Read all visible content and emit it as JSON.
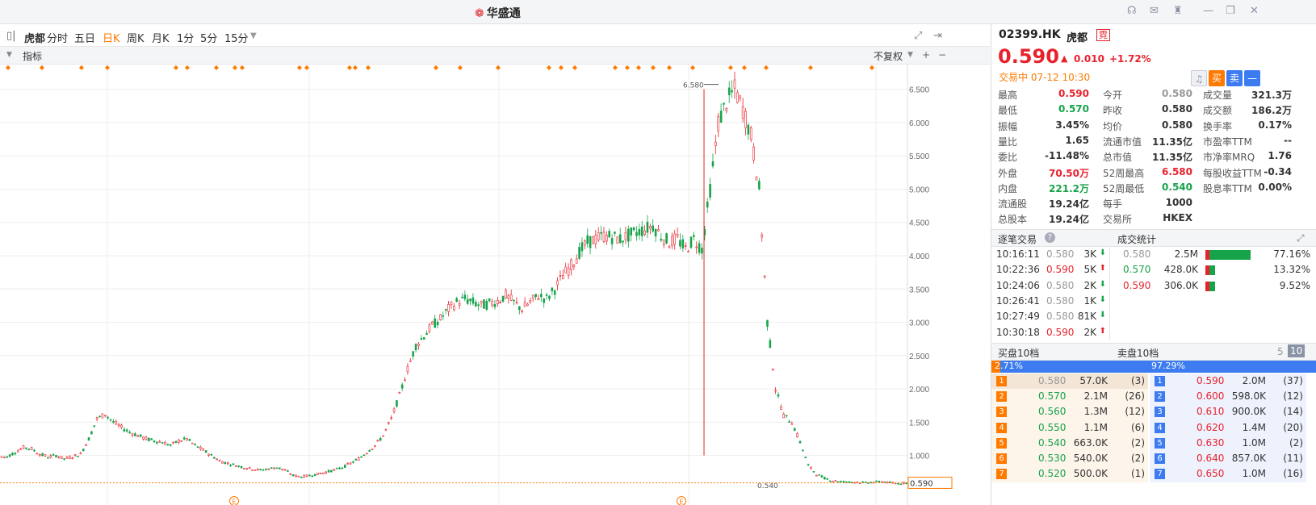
{
  "app": {
    "title": "华盛通"
  },
  "toolbar": {
    "name": "虎都",
    "periods": [
      "分时",
      "五日",
      "日K",
      "周K",
      "月K",
      "1分",
      "5分",
      "15分"
    ],
    "active_period": "日K"
  },
  "indicator_bar": {
    "label": "指标",
    "adjust": "不复权",
    "plus": "+",
    "minus": "−"
  },
  "chart_data": {
    "type": "candlestick",
    "yaxis_ticks": [
      "6.500",
      "6.000",
      "5.500",
      "5.000",
      "4.500",
      "4.000",
      "3.500",
      "3.000",
      "2.500",
      "2.000",
      "1.500",
      "1.000"
    ],
    "ylim": [
      0.45,
      6.75
    ],
    "current_price_label": "0.590",
    "annotations": {
      "high": "6.580",
      "low": "0.540"
    },
    "event_markers": [
      "E",
      "E"
    ],
    "closes_approx": [
      0.98,
      1.05,
      1.12,
      1.1,
      1.02,
      0.98,
      1.0,
      0.95,
      0.98,
      1.02,
      1.25,
      1.55,
      1.62,
      1.5,
      1.42,
      1.35,
      1.3,
      1.25,
      1.22,
      1.2,
      1.15,
      1.22,
      1.25,
      1.15,
      1.08,
      1.0,
      0.92,
      0.88,
      0.85,
      0.82,
      0.8,
      0.78,
      0.8,
      0.82,
      0.78,
      0.7,
      0.68,
      0.7,
      0.72,
      0.75,
      0.78,
      0.82,
      0.88,
      0.95,
      1.05,
      1.15,
      1.3,
      1.55,
      1.9,
      2.3,
      2.65,
      2.8,
      2.95,
      3.05,
      3.2,
      3.3,
      3.35,
      3.3,
      3.25,
      3.28,
      3.32,
      3.4,
      3.3,
      3.2,
      3.3,
      3.4,
      3.35,
      3.5,
      3.7,
      3.85,
      4.05,
      4.2,
      4.25,
      4.3,
      4.28,
      4.25,
      4.3,
      4.35,
      4.4,
      4.45,
      4.3,
      4.2,
      4.25,
      4.1,
      4.25,
      4.1,
      5.0,
      6.0,
      6.3,
      6.5,
      6.2,
      5.8,
      5.0,
      3.0,
      2.0,
      1.6,
      1.5,
      1.2,
      0.85,
      0.72,
      0.66,
      0.62,
      0.61,
      0.6,
      0.6,
      0.59,
      0.6,
      0.61,
      0.59,
      0.58,
      0.59
    ]
  },
  "quote": {
    "code": "02399.HK",
    "name": "虎都",
    "badge": "霓",
    "price": "0.590",
    "arrow": "▲",
    "change": "0.010",
    "change_pct": "+1.72%",
    "status": "交易中 07-12 10:30",
    "buy_label": "买",
    "sell_label": "卖",
    "menu_label": "—"
  },
  "stats": [
    [
      {
        "l": "最高",
        "v": "0.590",
        "c": "red"
      },
      {
        "l": "今开",
        "v": "0.580",
        "c": "grey"
      },
      {
        "l": "成交量",
        "v": "321.3万",
        "c": ""
      }
    ],
    [
      {
        "l": "最低",
        "v": "0.570",
        "c": "green"
      },
      {
        "l": "昨收",
        "v": "0.580",
        "c": ""
      },
      {
        "l": "成交额",
        "v": "186.2万",
        "c": ""
      }
    ],
    [
      {
        "l": "振幅",
        "v": "3.45%",
        "c": ""
      },
      {
        "l": "均价",
        "v": "0.580",
        "c": ""
      },
      {
        "l": "换手率",
        "v": "0.17%",
        "c": ""
      }
    ],
    [
      {
        "l": "量比",
        "v": "1.65",
        "c": ""
      },
      {
        "l": "流通市值",
        "v": "11.35亿",
        "c": ""
      },
      {
        "l": "市盈率TTM",
        "v": "--",
        "c": ""
      }
    ],
    [
      {
        "l": "委比",
        "v": "-11.48%",
        "c": ""
      },
      {
        "l": "总市值",
        "v": "11.35亿",
        "c": ""
      },
      {
        "l": "市净率MRQ",
        "v": "1.76",
        "c": ""
      }
    ],
    [
      {
        "l": "外盘",
        "v": "70.50万",
        "c": "red"
      },
      {
        "l": "52周最高",
        "v": "6.580",
        "c": "red"
      },
      {
        "l": "每股收益TTM",
        "v": "-0.34",
        "c": ""
      }
    ],
    [
      {
        "l": "内盘",
        "v": "221.2万",
        "c": "green"
      },
      {
        "l": "52周最低",
        "v": "0.540",
        "c": "green"
      },
      {
        "l": "股息率TTM",
        "v": "0.00%",
        "c": ""
      }
    ],
    [
      {
        "l": "流通股",
        "v": "19.24亿",
        "c": ""
      },
      {
        "l": "每手",
        "v": "1000",
        "c": ""
      },
      null
    ],
    [
      {
        "l": "总股本",
        "v": "19.24亿",
        "c": ""
      },
      {
        "l": "交易所",
        "v": "HKEX",
        "c": ""
      },
      null
    ]
  ],
  "ticks": {
    "title": "逐笔交易",
    "help": "?",
    "rows": [
      {
        "time": "10:16:11",
        "price": "0.580",
        "vol": "3K",
        "dir": "down",
        "c": "grey"
      },
      {
        "time": "10:22:36",
        "price": "0.590",
        "vol": "5K",
        "dir": "up",
        "c": "red"
      },
      {
        "time": "10:24:06",
        "price": "0.580",
        "vol": "2K",
        "dir": "down",
        "c": "grey"
      },
      {
        "time": "10:26:41",
        "price": "0.580",
        "vol": "1K",
        "dir": "down",
        "c": "grey"
      },
      {
        "time": "10:27:49",
        "price": "0.580",
        "vol": "81K",
        "dir": "down",
        "c": "grey"
      },
      {
        "time": "10:30:18",
        "price": "0.590",
        "vol": "2K",
        "dir": "up",
        "c": "red"
      }
    ]
  },
  "volstats": {
    "title": "成交统计",
    "rows": [
      {
        "price": "0.580",
        "vol": "2.5M",
        "pct": "77.16%",
        "frac": 0.7716,
        "c": "grey"
      },
      {
        "price": "0.570",
        "vol": "428.0K",
        "pct": "13.32%",
        "frac": 0.1332,
        "c": "green"
      },
      {
        "price": "0.590",
        "vol": "306.0K",
        "pct": "9.52%",
        "frac": 0.0952,
        "c": "red"
      }
    ]
  },
  "depth": {
    "bid_title": "买盘10档",
    "ask_title": "卖盘10档",
    "opt5": "5",
    "opt10": "10",
    "bid_pct": "2.71%",
    "ask_pct": "97.29%",
    "bid_frac": 0.0271,
    "bids": [
      {
        "n": "1",
        "price": "0.580",
        "vol": "57.0K",
        "cnt": "(3)",
        "c": "grey"
      },
      {
        "n": "2",
        "price": "0.570",
        "vol": "2.1M",
        "cnt": "(26)",
        "c": "green"
      },
      {
        "n": "3",
        "price": "0.560",
        "vol": "1.3M",
        "cnt": "(12)",
        "c": "green"
      },
      {
        "n": "4",
        "price": "0.550",
        "vol": "1.1M",
        "cnt": "(6)",
        "c": "green"
      },
      {
        "n": "5",
        "price": "0.540",
        "vol": "663.0K",
        "cnt": "(2)",
        "c": "green"
      },
      {
        "n": "6",
        "price": "0.530",
        "vol": "540.0K",
        "cnt": "(2)",
        "c": "green"
      },
      {
        "n": "7",
        "price": "0.520",
        "vol": "500.0K",
        "cnt": "(1)",
        "c": "green"
      }
    ],
    "asks": [
      {
        "n": "1",
        "price": "0.590",
        "vol": "2.0M",
        "cnt": "(37)",
        "c": "red"
      },
      {
        "n": "2",
        "price": "0.600",
        "vol": "598.0K",
        "cnt": "(12)",
        "c": "red"
      },
      {
        "n": "3",
        "price": "0.610",
        "vol": "900.0K",
        "cnt": "(14)",
        "c": "red"
      },
      {
        "n": "4",
        "price": "0.620",
        "vol": "1.4M",
        "cnt": "(20)",
        "c": "red"
      },
      {
        "n": "5",
        "price": "0.630",
        "vol": "1.0M",
        "cnt": "(2)",
        "c": "red"
      },
      {
        "n": "6",
        "price": "0.640",
        "vol": "857.0K",
        "cnt": "(11)",
        "c": "red"
      },
      {
        "n": "7",
        "price": "0.650",
        "vol": "1.0M",
        "cnt": "(16)",
        "c": "red"
      }
    ]
  },
  "colors": {
    "up": "#e8222d",
    "down": "#17a34a",
    "accent": "#ff7a00",
    "blue": "#3d7cf0"
  }
}
